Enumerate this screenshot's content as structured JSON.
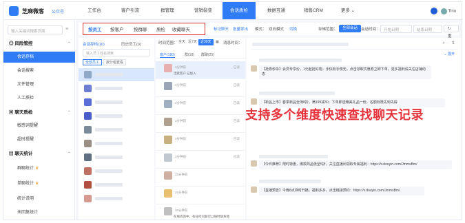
{
  "app": {
    "brand": "芝麻微客",
    "brand_sub": "公众号"
  },
  "nav": {
    "items": [
      {
        "label": "工作台"
      },
      {
        "label": "客户引流"
      },
      {
        "label": "群管理"
      },
      {
        "label": "营销裂变"
      },
      {
        "label": "会话质检",
        "active": true
      },
      {
        "label": "数据互通"
      },
      {
        "label": "销售CRM"
      },
      {
        "label": "更多 ⌄"
      }
    ],
    "user": "Tina"
  },
  "sidebar": {
    "search_placeholder": "输入关键词搜索页面",
    "groups": [
      {
        "label": "风险管控",
        "items": [
          {
            "label": "会话存档",
            "active": true
          },
          {
            "label": "会话搜索"
          },
          {
            "label": "文件管理"
          },
          {
            "label": "人工质检"
          }
        ]
      },
      {
        "label": "聊天质检",
        "items": [
          {
            "label": "敏感词提醒"
          },
          {
            "label": "超时提醒"
          }
        ]
      },
      {
        "label": "聊天统计",
        "items": [
          {
            "label": "群聊统计",
            "crown": true
          },
          {
            "label": "单聊统计",
            "crown": true
          },
          {
            "label": "统计说明"
          },
          {
            "label": "未回复统计"
          }
        ]
      }
    ]
  },
  "filterbar": {
    "tabs": [
      "按员工",
      "按客户",
      "按群聊",
      "质检",
      "收藏聊天"
    ],
    "hint1": "标记聊天",
    "hint2": "批量导出",
    "mode_label": "模式：",
    "mode_value": "双向模式",
    "mode_switch": "切换",
    "store_label": "存储范围：",
    "store_value": "全部会话",
    "time_label": "会话时间：",
    "range_start": "开始日期",
    "range_end": "结束日期",
    "reset": "重置"
  },
  "staff_panel": {
    "title_left": "会话存档(10)",
    "title_right": "历史员工(0)",
    "search_placeholder": "输入员工姓名搜索",
    "chips": [
      "全部员工",
      "按分组查看"
    ]
  },
  "customer_panel": {
    "time_label": "时间范围：",
    "time_options": [
      "全天",
      "近7天",
      "近30天"
    ],
    "chat_label": "消息时间：",
    "chat_options": [
      "全部",
      "单聊",
      "群聊"
    ],
    "cust_label": "客户标签：",
    "cust_placeholder": "选择客户标签",
    "tabs": [
      "客户(180)",
      "群(18)",
      "群聊(25)"
    ],
    "rows": [
      {
        "time": "3分钟前",
        "deleted": "已读",
        "msg": "活跃客户 已加入",
        "active": true
      },
      {
        "time": "3分钟前",
        "deleted": "已读",
        "msg": ""
      },
      {
        "time": "3分钟前",
        "deleted": "已读",
        "msg": ""
      },
      {
        "time": "3分钟前",
        "deleted": "已读",
        "msg": ""
      },
      {
        "time": "3分钟前",
        "deleted": "已读",
        "msg": ""
      },
      {
        "time": "3分钟前",
        "deleted": "已读",
        "msg": ""
      },
      {
        "time": "25分钟前",
        "deleted": "",
        "msg": ""
      },
      {
        "time": "25分钟前",
        "deleted": "",
        "msg": ""
      },
      {
        "time": "25分钟前",
        "deleted": "",
        "msg": "在线咨询中，有任何问题可以随时联系我"
      }
    ]
  },
  "chat": {
    "overlay": "支持多个维度快速查找聊天记录",
    "messages": [
      "【抢券秒杀】会员专享价，1元起抢好物，手快有手慢无，点击领取优惠券立即下单，更多福利请关注店铺动态",
      "【新品上市】春季新品全场8折，满199减30，下单即送精美礼品一份，名额有限先到先得",
      "【今日推荐】限时特惠，爆款商品低至5折，关注直播间领取专属福利：https://v.douyin.com/JmmsBm/",
      "【直播预告】今晚8点准时开播，福利多多，点击链接预约：https://v.douyin.com/JmmsBm/"
    ]
  },
  "colors": {
    "primary": "#2f7cf6",
    "accent_red": "#e5333c",
    "crown": "#f0a020"
  }
}
